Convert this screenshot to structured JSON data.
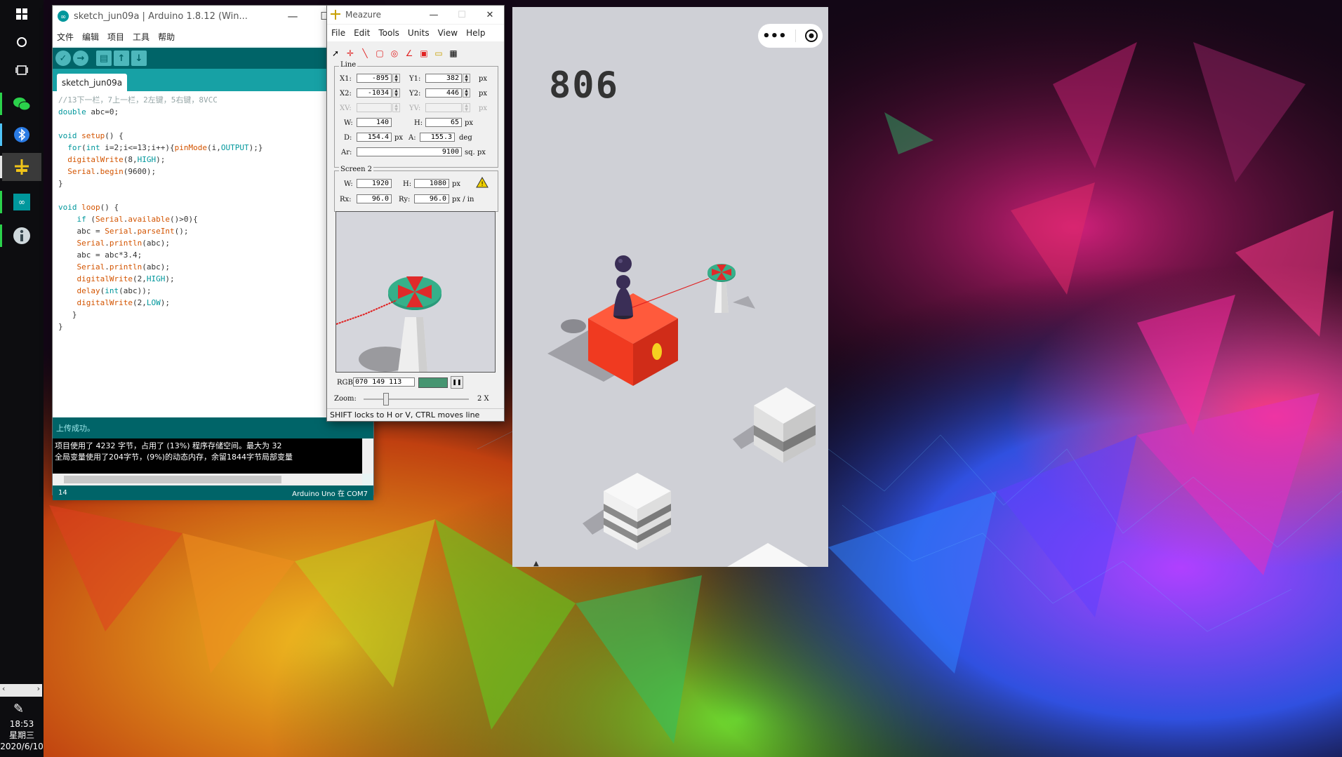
{
  "taskbar": {
    "icons": [
      "windows-start-icon",
      "cortana-icon",
      "task-view-icon",
      "wechat-icon",
      "bluetooth-icon",
      "meazure-icon",
      "arduino-icon",
      "info-icon"
    ],
    "clock_time": "18:53",
    "clock_day": "星期三",
    "clock_date": "2020/6/10"
  },
  "arduino": {
    "title": "sketch_jun09a | Arduino 1.8.12 (Win...",
    "menu": [
      "文件",
      "编辑",
      "项目",
      "工具",
      "帮助"
    ],
    "tab": "sketch_jun09a",
    "code_lines": [
      "//13下一栏，7上一栏，2左键，5右键，8VCC",
      "double abc=0;",
      "",
      "void setup() {",
      "  for(int i=2;i<=13;i++){pinMode(i,OUTPUT);}",
      "  digitalWrite(8,HIGH);",
      "  Serial.begin(9600);",
      "}",
      "",
      "void loop() {",
      "    if (Serial.available()>0){",
      "    abc = Serial.parseInt();",
      "    Serial.println(abc);",
      "    abc = abc*3.4;",
      "    Serial.println(abc);",
      "    digitalWrite(2,HIGH);",
      "    delay(int(abc));",
      "    digitalWrite(2,LOW);",
      "   }",
      "}"
    ],
    "status": "上传成功。",
    "console_lines": [
      "项目使用了 4232 字节，占用了 (13%) 程序存储空间。最大为 32",
      "全局变量使用了204字节，(9%)的动态内存，余留1844字节局部变量"
    ],
    "line_number": "14",
    "board": "Arduino Uno 在 COM7"
  },
  "meazure": {
    "title": "Meazure",
    "menu": [
      "File",
      "Edit",
      "Tools",
      "Units",
      "View",
      "Help"
    ],
    "line_group": "Line",
    "x1": "-895",
    "y1": "382",
    "x2": "-1034",
    "y2": "446",
    "xv": "",
    "yv": "",
    "w": "140",
    "h": "65",
    "d": "154.4",
    "a": "155.3",
    "ar": "9100",
    "unit_px": "px",
    "unit_deg": "deg",
    "unit_sqpx": "sq. px",
    "labels": {
      "x1": "X1:",
      "y1": "Y1:",
      "x2": "X2:",
      "y2": "Y2:",
      "xv": "XV:",
      "yv": "YV:",
      "w": "W:",
      "h": "H:",
      "d": "D:",
      "a": "A:",
      "ar": "Ar:",
      "rx": "Rx:",
      "ry": "Ry:",
      "rgb": "RGB:",
      "zoom": "Zoom:"
    },
    "screen_group": "Screen 2",
    "screen_w": "1920",
    "screen_h": "1080",
    "rx": "96.0",
    "ry": "96.0",
    "res_unit": "px / in",
    "rgb": "070 149 113",
    "rgb_color": "#469571",
    "zoom_value": "2 X",
    "status": "SHIFT locks to H or V, CTRL moves line"
  },
  "game": {
    "score": "806"
  }
}
